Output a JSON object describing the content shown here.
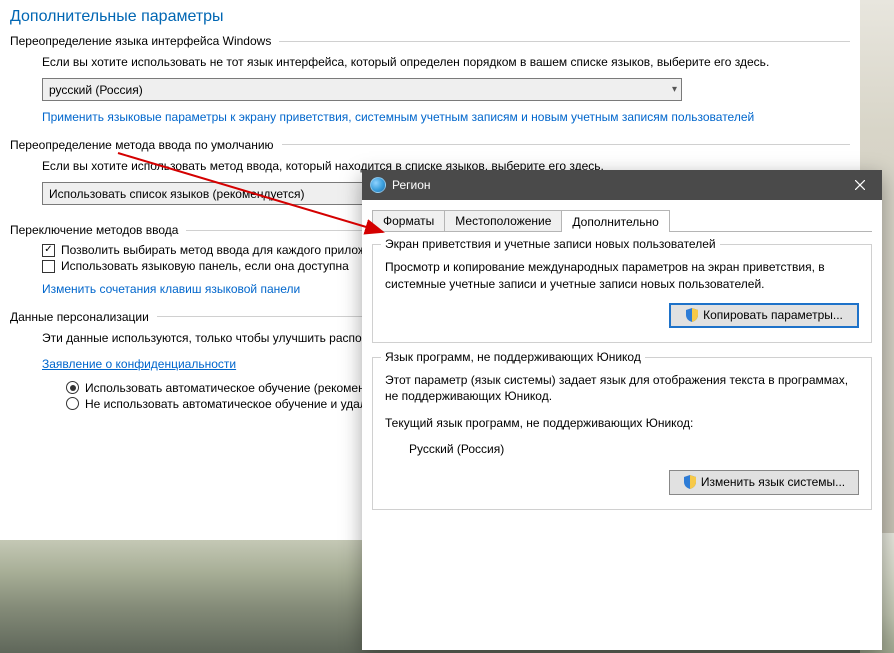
{
  "page": {
    "title": "Дополнительные параметры"
  },
  "group_override_lang": {
    "label": "Переопределение языка интерфейса Windows",
    "desc": "Если вы хотите использовать не тот язык интерфейса, который определен порядком в вашем списке языков, выберите его здесь.",
    "combo_value": "русский (Россия)",
    "link": "Применить языковые параметры к экрану приветствия, системным учетным записям и новым учетным записям пользователей"
  },
  "group_override_input": {
    "label": "Переопределение метода ввода по умолчанию",
    "desc": "Если вы хотите использовать метод ввода, который находится в списке языков, выберите его здесь.",
    "combo_value": "Использовать список языков (рекомендуется)"
  },
  "group_switching": {
    "label": "Переключение методов ввода",
    "cb1": "Позволить выбирать метод ввода для каждого приложения",
    "cb1_checked": true,
    "cb2": "Использовать языковую панель, если она доступна",
    "cb2_checked": false,
    "link": "Изменить сочетания клавиш языковой панели"
  },
  "group_personalization": {
    "label": "Данные персонализации",
    "desc": "Эти данные используются, только чтобы улучшить распознавание для языков без IME на этом компьютере. Никакая информация",
    "privacy_link": "Заявление о конфиденциальности",
    "radio1": "Использовать автоматическое обучение (рекомендуется)",
    "radio2": "Не использовать автоматическое обучение и удалить"
  },
  "dialog": {
    "title": "Регион",
    "tabs": [
      "Форматы",
      "Местоположение",
      "Дополнительно"
    ],
    "active_tab": 2,
    "welcome_group": {
      "legend": "Экран приветствия и учетные записи новых пользователей",
      "desc": "Просмотр и копирование международных параметров на экран приветствия, в системные учетные записи и учетные записи новых пользователей.",
      "button": "Копировать параметры..."
    },
    "nonunicode_group": {
      "legend": "Язык программ, не поддерживающих Юникод",
      "desc": "Этот параметр (язык системы) задает язык для отображения текста в программах, не поддерживающих Юникод.",
      "current_label": "Текущий язык программ, не поддерживающих Юникод:",
      "current_value": "Русский (Россия)",
      "button": "Изменить язык системы..."
    }
  }
}
